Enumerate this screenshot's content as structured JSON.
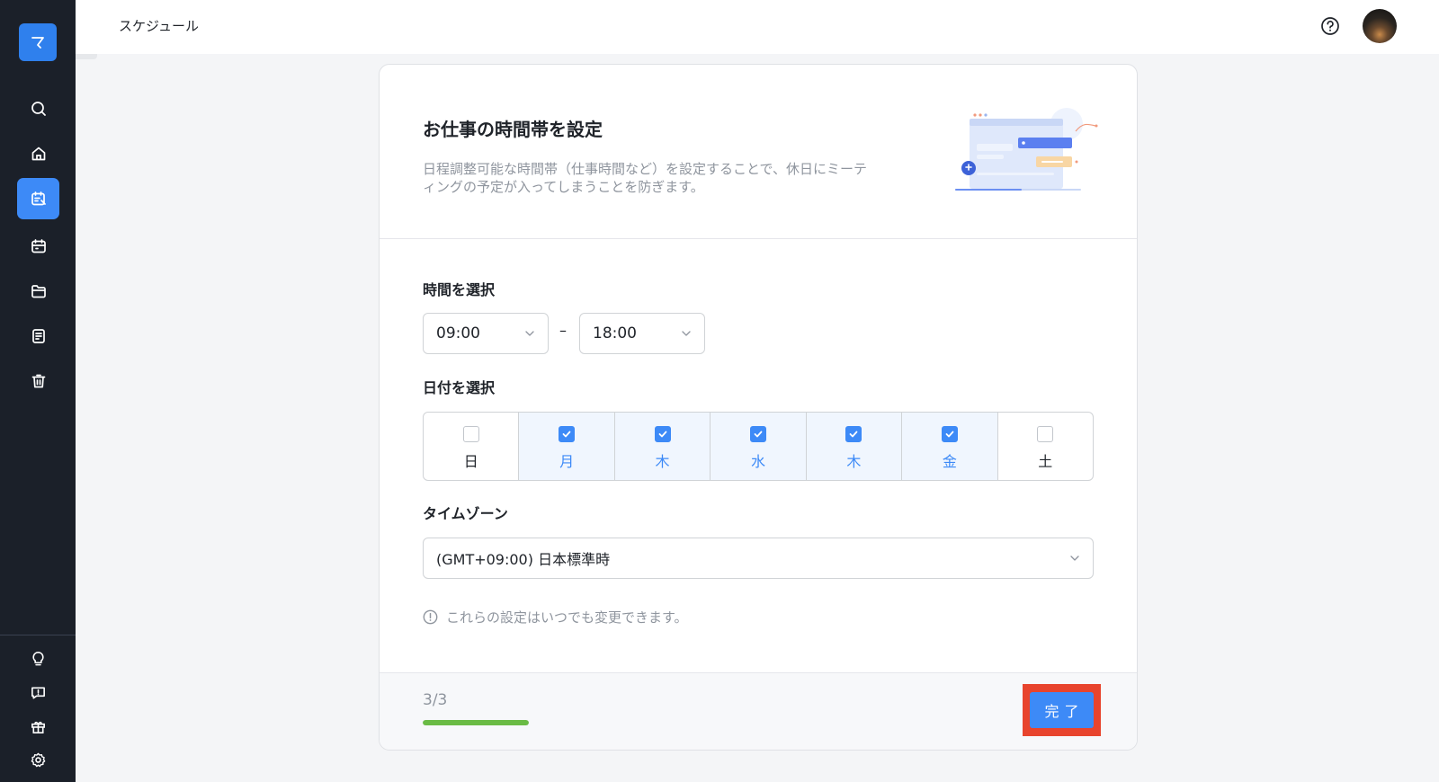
{
  "sidebar": {
    "logo_glyph": "マ",
    "nav": [
      {
        "name": "search",
        "icon": "search-icon"
      },
      {
        "name": "home",
        "icon": "home-icon"
      },
      {
        "name": "schedule",
        "icon": "calendar-edit-icon",
        "active": true
      },
      {
        "name": "calendar",
        "icon": "calendar-icon"
      },
      {
        "name": "folder",
        "icon": "folder-icon"
      },
      {
        "name": "document",
        "icon": "document-icon"
      },
      {
        "name": "trash",
        "icon": "trash-icon"
      }
    ],
    "bottom": [
      {
        "name": "tips",
        "icon": "lightbulb-icon"
      },
      {
        "name": "feedback",
        "icon": "feedback-icon"
      },
      {
        "name": "gift",
        "icon": "gift-icon"
      },
      {
        "name": "settings",
        "icon": "gear-icon"
      }
    ]
  },
  "header": {
    "title": "スケジュール"
  },
  "card": {
    "title": "お仕事の時間帯を設定",
    "description": "日程調整可能な時間帯（仕事時間など）を設定することで、休日にミーティングの予定が入ってしまうことを防ぎます。",
    "time_section": {
      "label": "時間を選択",
      "start": "09:00",
      "separator": "–",
      "end": "18:00"
    },
    "date_section": {
      "label": "日付を選択",
      "days": [
        {
          "label": "日",
          "checked": false
        },
        {
          "label": "月",
          "checked": true
        },
        {
          "label": "木",
          "checked": true
        },
        {
          "label": "水",
          "checked": true
        },
        {
          "label": "木",
          "checked": true
        },
        {
          "label": "金",
          "checked": true
        },
        {
          "label": "土",
          "checked": false
        }
      ]
    },
    "timezone_section": {
      "label": "タイムゾーン",
      "value": "(GMT+09:00) 日本標準時"
    },
    "note": "これらの設定はいつでも変更できます。",
    "footer": {
      "step": "3/3",
      "progress_fraction": 1.0,
      "done_label": "完了"
    }
  },
  "colors": {
    "accent": "#3d8af7",
    "progress": "#6abb45",
    "highlight": "#e8442d",
    "sidebar_bg": "#1b2029"
  }
}
